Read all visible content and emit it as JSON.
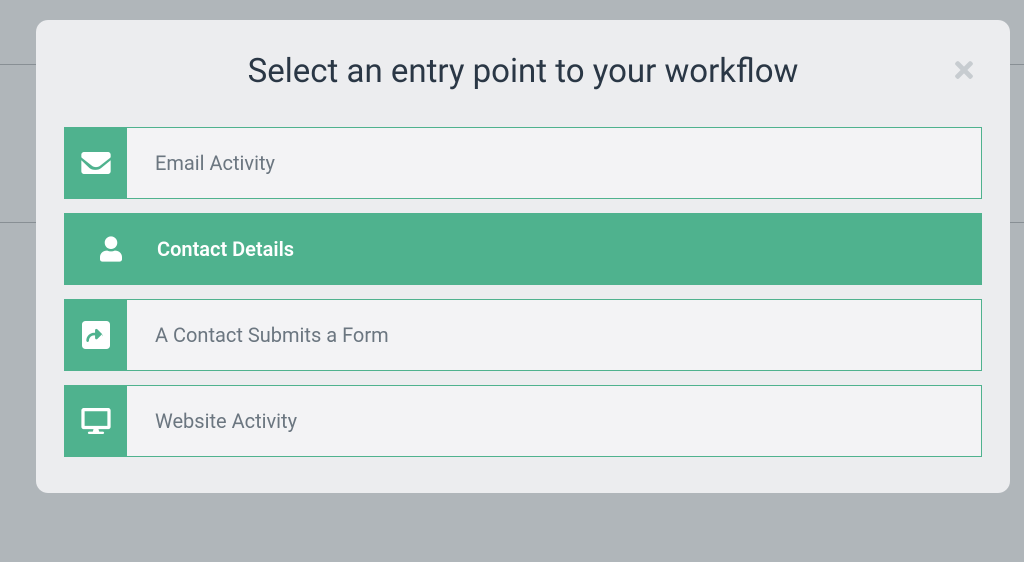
{
  "modal": {
    "title": "Select an entry point to your workflow",
    "options": [
      {
        "label": "Email Activity",
        "icon": "envelope-icon"
      },
      {
        "label": "Contact Details",
        "icon": "user-icon"
      },
      {
        "label": "A Contact Submits a Form",
        "icon": "share-icon"
      },
      {
        "label": "Website Activity",
        "icon": "monitor-icon"
      }
    ]
  }
}
